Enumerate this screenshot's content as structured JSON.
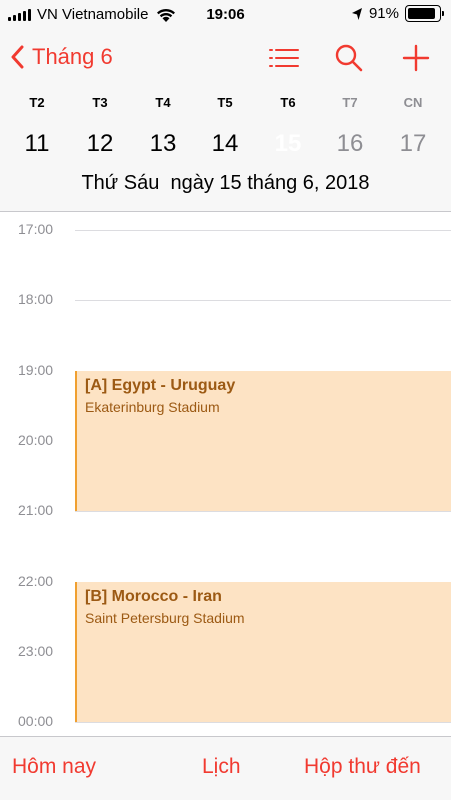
{
  "status_bar": {
    "carrier": "VN Vietnamobile",
    "time": "19:06",
    "battery": "91%",
    "battery_level": 0.91
  },
  "nav": {
    "back_label": "Tháng 6",
    "icons": [
      "list-icon",
      "search-icon",
      "add-icon"
    ]
  },
  "week": {
    "days": [
      {
        "weekday": "T2",
        "date": "11"
      },
      {
        "weekday": "T3",
        "date": "12"
      },
      {
        "weekday": "T4",
        "date": "13"
      },
      {
        "weekday": "T5",
        "date": "14"
      },
      {
        "weekday": "T6",
        "date": "15"
      },
      {
        "weekday": "T7",
        "date": "16"
      },
      {
        "weekday": "CN",
        "date": "17"
      }
    ],
    "selected_date": "15",
    "full_date_weekday": "Thứ Sáu",
    "full_date_text": "ngày 15 tháng 6, 2018"
  },
  "timeline": {
    "hours": [
      "17:00",
      "18:00",
      "19:00",
      "20:00",
      "21:00",
      "22:00",
      "23:00",
      "00:00"
    ],
    "events": [
      {
        "title": "[A] Egypt - Uruguay",
        "location": "Ekaterinburg Stadium",
        "start": "19:00",
        "end": "21:00"
      },
      {
        "title": "[B] Morocco - Iran",
        "location": "Saint Petersburg Stadium",
        "start": "22:00",
        "end": "00:00"
      }
    ]
  },
  "toolbar": {
    "today_label": "Hôm nay",
    "calendars_label": "Lịch",
    "inbox_label": "Hộp thư đến"
  },
  "colors": {
    "accent": "#f13a30",
    "event_bg": "#fde3c4",
    "event_border": "#f0a030",
    "event_text": "#9c5a14"
  }
}
